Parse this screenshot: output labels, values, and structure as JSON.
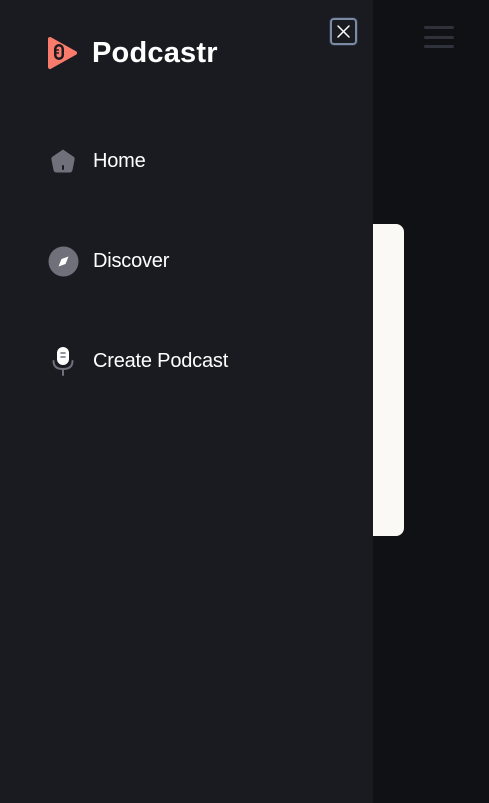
{
  "app": {
    "name": "Podcastr"
  },
  "nav": {
    "items": [
      {
        "label": "Home",
        "icon": "home-icon"
      },
      {
        "label": "Discover",
        "icon": "compass-icon"
      },
      {
        "label": "Create Podcast",
        "icon": "microphone-icon"
      }
    ]
  },
  "controls": {
    "close": {
      "icon": "close-icon"
    },
    "menu": {
      "icon": "hamburger-menu-icon"
    }
  },
  "colors": {
    "brand": "#f97b6c",
    "drawer_bg": "#1a1b20",
    "page_bg": "#101114",
    "icon_gray": "#6f7079",
    "text": "#ffffff"
  }
}
